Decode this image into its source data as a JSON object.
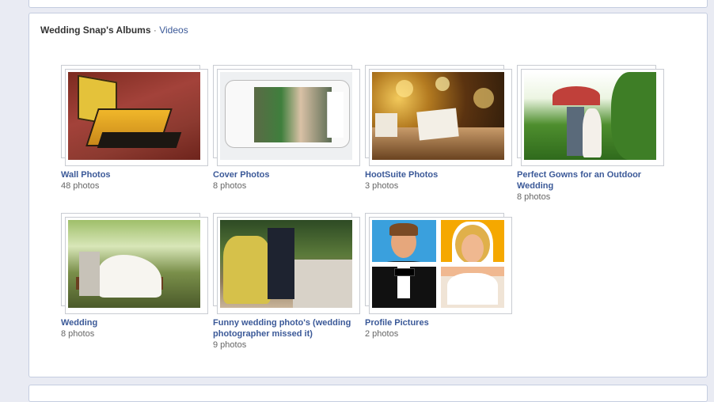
{
  "heading": {
    "owner_albums": "Wedding Snap's Albums",
    "separator": "·",
    "videos_link": "Videos"
  },
  "albums": [
    {
      "title": "Wall Photos",
      "count": "48 photos"
    },
    {
      "title": "Cover Photos",
      "count": "8 photos"
    },
    {
      "title": "HootSuite Photos",
      "count": "3 photos"
    },
    {
      "title": "Perfect Gowns for an Outdoor Wedding",
      "count": "8 photos"
    },
    {
      "title": "Wedding",
      "count": "8 photos"
    },
    {
      "title": "Funny wedding photo's (wedding photographer missed it)",
      "count": "9 photos"
    },
    {
      "title": "Profile Pictures",
      "count": "2 photos"
    }
  ],
  "colors": {
    "link": "#3b5998",
    "page_bg": "#e9ebf3",
    "panel_border": "#c4cde0"
  }
}
